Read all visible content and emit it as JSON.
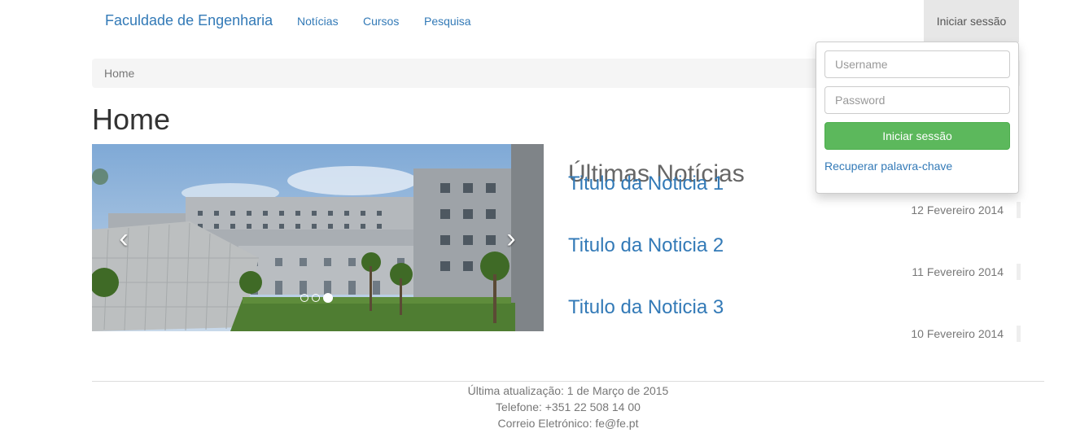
{
  "navbar": {
    "brand": "Faculdade de Engenharia",
    "links": [
      "Notícias",
      "Cursos",
      "Pesquisa"
    ],
    "login_label": "Iniciar sessão"
  },
  "breadcrumb": {
    "current": "Home"
  },
  "page": {
    "title": "Home"
  },
  "carousel": {
    "prev_glyph": "‹",
    "next_glyph": "›",
    "slide_count": 3,
    "active_slide": 3
  },
  "news": {
    "heading": "Últimas Notícias",
    "items": [
      {
        "title": "Titulo da Noticia 1",
        "date": "12 Fevereiro 2014"
      },
      {
        "title": "Titulo da Noticia 2",
        "date": "11 Fevereiro 2014"
      },
      {
        "title": "Titulo da Noticia 3",
        "date": "10 Fevereiro 2014"
      }
    ]
  },
  "footer": {
    "updated": "Última atualização: 1 de Março de 2015",
    "phone": "Telefone: +351 22 508 14 00",
    "email": "Correio Eletrónico: fe@fe.pt"
  },
  "login": {
    "username_placeholder": "Username",
    "password_placeholder": "Password",
    "submit_label": "Iniciar sessão",
    "recover_label": "Recuperar palavra-chave"
  },
  "colors": {
    "link": "#337ab7",
    "success": "#5cb85c",
    "breadcrumb_bg": "#f5f5f5",
    "nav_active_bg": "#e7e7e7"
  }
}
